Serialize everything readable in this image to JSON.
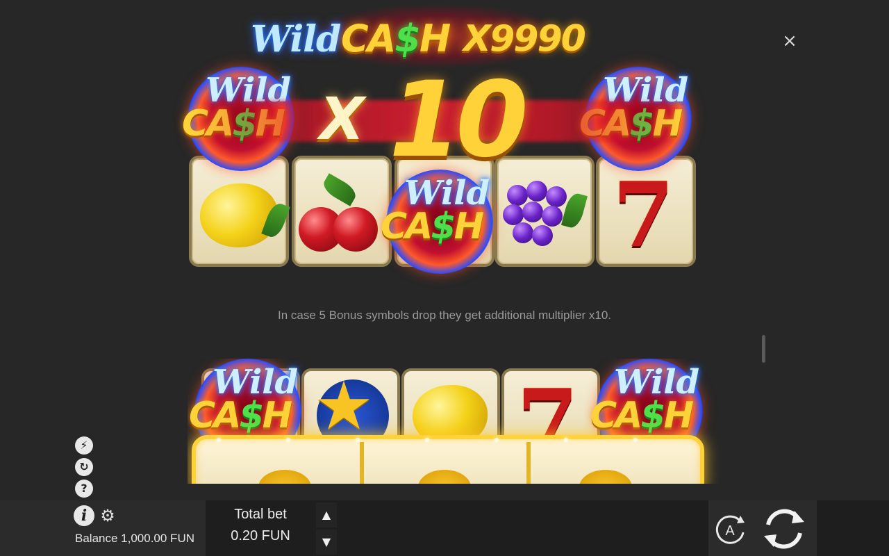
{
  "logo": {
    "wild": "Wild",
    "cash_pre": "CA",
    "cash_dollar": "$",
    "cash_post": "H",
    "multiplier": "X9990"
  },
  "close_glyph": "×",
  "badge": {
    "wild": "Wild",
    "cash_pre": "CA",
    "cash_dollar": "$",
    "cash_post": "H"
  },
  "x10": {
    "x": "X",
    "number": "10"
  },
  "seven": "7",
  "star": "★",
  "description": "In case 5 Bonus symbols drop they get additional multiplier x10.",
  "side_icons": [
    {
      "name": "turbo-icon",
      "glyph": "⚡"
    },
    {
      "name": "autoplay-history-icon",
      "glyph": "↻"
    },
    {
      "name": "help-icon",
      "glyph": "?"
    }
  ],
  "bottom_bar": {
    "info_glyph": "i",
    "gear_glyph": "⚙",
    "balance": "Balance 1,000.00 FUN",
    "total_bet_label": "Total bet",
    "total_bet_value": "0.20 FUN",
    "up_glyph": "▲",
    "down_glyph": "▼",
    "auto_label": "A"
  },
  "colors": {
    "background": "#272727",
    "gold": "#ffd23a",
    "green": "#4ee04a",
    "neon_blue": "#bfe9ff",
    "red": "#c81a1a"
  }
}
